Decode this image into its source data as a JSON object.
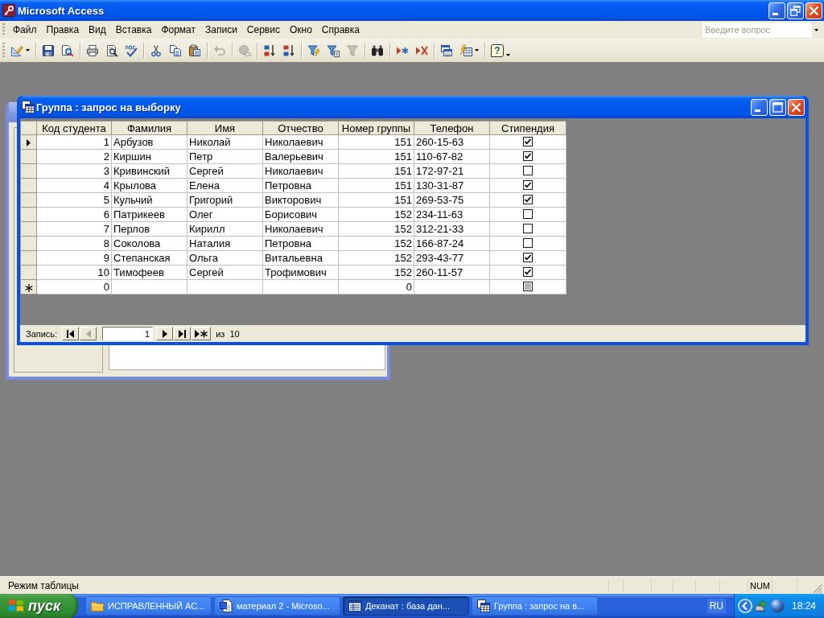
{
  "window": {
    "title": "Microsoft Access"
  },
  "menu": [
    "Файл",
    "Правка",
    "Вид",
    "Вставка",
    "Формат",
    "Записи",
    "Сервис",
    "Окно",
    "Справка"
  ],
  "help_box": {
    "placeholder": "Введите вопрос"
  },
  "toolbar": [
    [
      {
        "kind": "design",
        "dropdown": true,
        "disabled": false
      }
    ],
    [
      {
        "kind": "save",
        "dropdown": false,
        "disabled": false
      },
      {
        "kind": "search",
        "dropdown": false,
        "disabled": false
      }
    ],
    [
      {
        "kind": "print",
        "dropdown": false,
        "disabled": false
      },
      {
        "kind": "preview",
        "dropdown": false,
        "disabled": false
      },
      {
        "kind": "spelling",
        "dropdown": false,
        "disabled": false
      }
    ],
    [
      {
        "kind": "cut",
        "dropdown": false,
        "disabled": false
      },
      {
        "kind": "copy",
        "dropdown": false,
        "disabled": false
      },
      {
        "kind": "paste",
        "dropdown": false,
        "disabled": false
      }
    ],
    [
      {
        "kind": "undo",
        "dropdown": false,
        "disabled": true
      }
    ],
    [
      {
        "kind": "hyperlink",
        "dropdown": false,
        "disabled": true
      }
    ],
    [
      {
        "kind": "sortasc",
        "dropdown": false,
        "disabled": false
      },
      {
        "kind": "sortdesc",
        "dropdown": false,
        "disabled": false
      }
    ],
    [
      {
        "kind": "selfilter",
        "dropdown": false,
        "disabled": false
      },
      {
        "kind": "formfilter",
        "dropdown": false,
        "disabled": false
      },
      {
        "kind": "filter",
        "dropdown": false,
        "disabled": true
      }
    ],
    [
      {
        "kind": "find",
        "dropdown": false,
        "disabled": false
      }
    ],
    [
      {
        "kind": "newrecord",
        "dropdown": false,
        "disabled": false
      },
      {
        "kind": "deleterecord",
        "dropdown": false,
        "disabled": false
      }
    ],
    [
      {
        "kind": "dbwindow",
        "dropdown": false,
        "disabled": false
      },
      {
        "kind": "newobject",
        "dropdown": true,
        "disabled": false
      }
    ],
    [
      {
        "kind": "help",
        "label": "?",
        "dropdown": true,
        "disabled": false
      }
    ]
  ],
  "datasheet": {
    "title": "Группа : запрос на выборку",
    "columns": [
      {
        "label": "Код студента",
        "kind": "number"
      },
      {
        "label": "Фамилия",
        "kind": "text"
      },
      {
        "label": "Имя",
        "kind": "text"
      },
      {
        "label": "Отчество",
        "kind": "text"
      },
      {
        "label": "Номер группы",
        "kind": "number"
      },
      {
        "label": "Телефон",
        "kind": "text"
      },
      {
        "label": "Стипендия",
        "kind": "check"
      }
    ],
    "rows": [
      {
        "current": true,
        "cells": [
          "1",
          "Арбузов",
          "Николай",
          "Николаевич",
          "151",
          "260-15-63"
        ],
        "checked": true
      },
      {
        "current": false,
        "cells": [
          "2",
          "Киршин",
          "Петр",
          "Валерьевич",
          "151",
          "110-67-82"
        ],
        "checked": true
      },
      {
        "current": false,
        "cells": [
          "3",
          "Кривинский",
          "Сергей",
          "Николаевич",
          "151",
          "172-97-21"
        ],
        "checked": false
      },
      {
        "current": false,
        "cells": [
          "4",
          "Крылова",
          "Елена",
          "Петровна",
          "151",
          "130-31-87"
        ],
        "checked": true
      },
      {
        "current": false,
        "cells": [
          "5",
          "Кульчий",
          "Григорий",
          "Викторович",
          "151",
          "269-53-75"
        ],
        "checked": true
      },
      {
        "current": false,
        "cells": [
          "6",
          "Патрикеев",
          "Олег",
          "Борисович",
          "152",
          "234-11-63"
        ],
        "checked": false
      },
      {
        "current": false,
        "cells": [
          "7",
          "Перлов",
          "Кирилл",
          "Николаевич",
          "152",
          "312-21-33"
        ],
        "checked": false
      },
      {
        "current": false,
        "cells": [
          "8",
          "Соколова",
          "Наталия",
          "Петровна",
          "152",
          "166-87-24"
        ],
        "checked": false
      },
      {
        "current": false,
        "cells": [
          "9",
          "Степанская",
          "Ольга",
          "Витальевна",
          "152",
          "293-43-77"
        ],
        "checked": true
      },
      {
        "current": false,
        "cells": [
          "10",
          "Тимофеев",
          "Сергей",
          "Трофимович",
          "152",
          "260-11-57"
        ],
        "checked": true
      }
    ],
    "new_row": {
      "defaults": [
        "0",
        "0"
      ],
      "indeterminate": true
    },
    "navigation": {
      "label": "Запись:",
      "current": "1",
      "count": "из  10",
      "buttons": [
        {
          "kind": "first",
          "disabled": false
        },
        {
          "kind": "prev",
          "disabled": true
        },
        {
          "kind": "next",
          "disabled": false
        },
        {
          "kind": "last",
          "disabled": false
        },
        {
          "kind": "new",
          "disabled": false
        }
      ]
    }
  },
  "status_bar": {
    "text": "Режим таблицы",
    "indicators": [
      "NUM"
    ]
  },
  "taskbar": {
    "start": "пуск",
    "tasks": [
      {
        "label": "ИСПРАВЛЕННЫЙ АС...",
        "kind": "folder",
        "selected": false
      },
      {
        "label": "материал 2 - Microso...",
        "kind": "document",
        "selected": false
      },
      {
        "label": "Деканат : база дан...",
        "kind": "database",
        "selected": true
      },
      {
        "label": "Группа : запрос на в...",
        "kind": "datasheet",
        "selected": false
      }
    ],
    "language": "RU",
    "clock": "18:24"
  }
}
